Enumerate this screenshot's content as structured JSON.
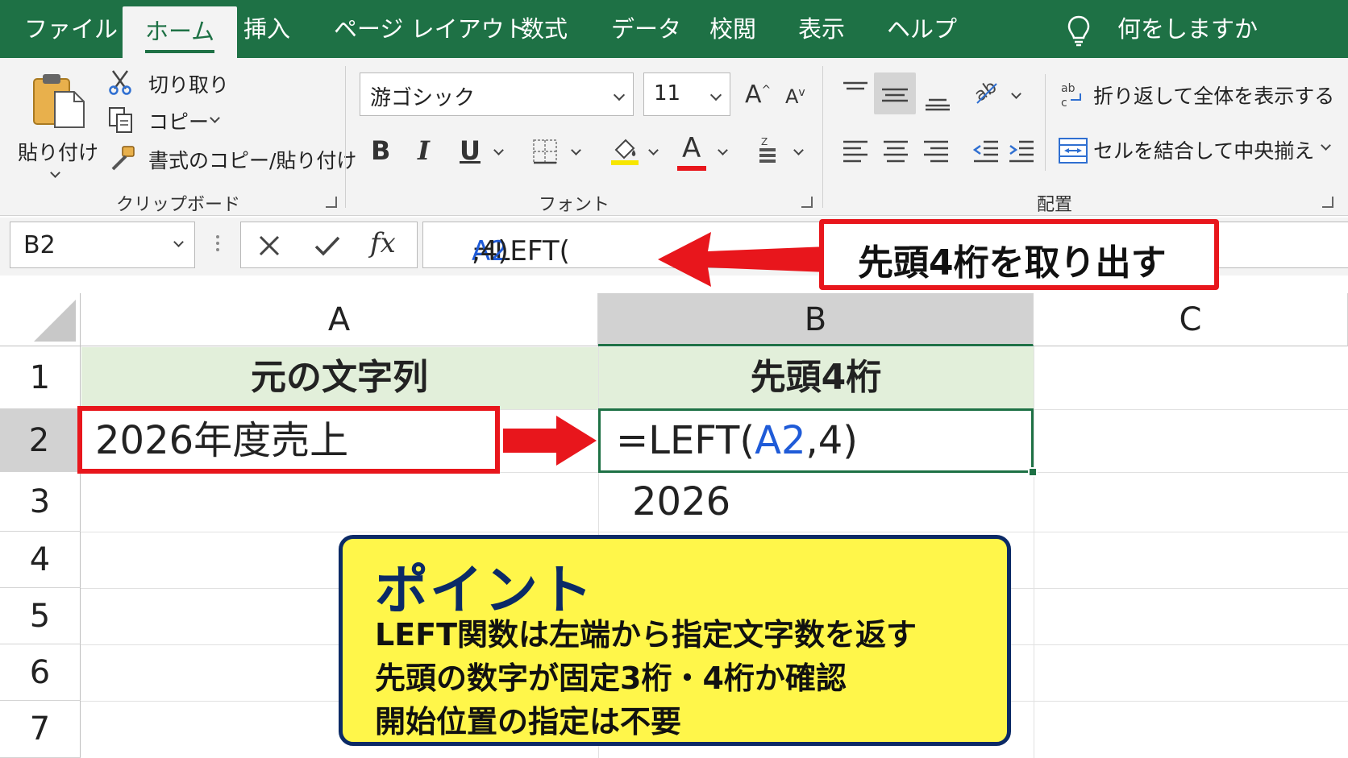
{
  "tabs": [
    "ファイル",
    "ホーム",
    "挿入",
    "ページ レイアウト",
    "数式",
    "データ",
    "校閲",
    "表示",
    "ヘルプ"
  ],
  "active_tab": "ホーム",
  "tell_me": "何をしますか",
  "clipboard": {
    "paste": "貼り付け",
    "cut": "切り取り",
    "copy": "コピー",
    "format_painter": "書式のコピー/貼り付け",
    "group_label": "クリップボード"
  },
  "font": {
    "name": "游ゴシック",
    "size": "11",
    "bold": "B",
    "italic": "I",
    "underline": "U",
    "grow": "A",
    "shrink": "A",
    "font_color_letter": "A",
    "fill_color": "#f7e600",
    "font_color": "#e8161c",
    "group_label": "フォント"
  },
  "alignment": {
    "wrap_text": "折り返して全体を表示する",
    "merge_center": "セルを結合して中央揃え",
    "group_label": "配置"
  },
  "formula_bar": {
    "name_box": "B2",
    "fx": "fx",
    "formula_prefix": "=LEFT(",
    "formula_ref": "A2",
    "formula_suffix": ",4)"
  },
  "callout_top": "先頭4桁を取り出す",
  "columns": [
    "A",
    "B",
    "C"
  ],
  "rows": [
    "1",
    "2",
    "3",
    "4",
    "5",
    "6",
    "7"
  ],
  "cells": {
    "A1": "元の文字列",
    "B1": "先頭4桁",
    "A2": "2026年度売上",
    "B2_prefix": "=LEFT(",
    "B2_ref": "A2",
    "B2_suffix": ",4)",
    "B3": "2026"
  },
  "point_box": {
    "title": "ポイント",
    "lines": [
      "LEFT関数は左端から指定文字数を返す",
      "先頭の数字が固定3桁・4桁か確認",
      "開始位置の指定は不要"
    ]
  },
  "colors": {
    "excel_green": "#1e7145",
    "header_fill": "#e2efda",
    "annotation_red": "#e8161c",
    "point_yellow": "#fff64a",
    "point_border": "#0b2a66",
    "ref_blue": "#1f5bd8"
  }
}
